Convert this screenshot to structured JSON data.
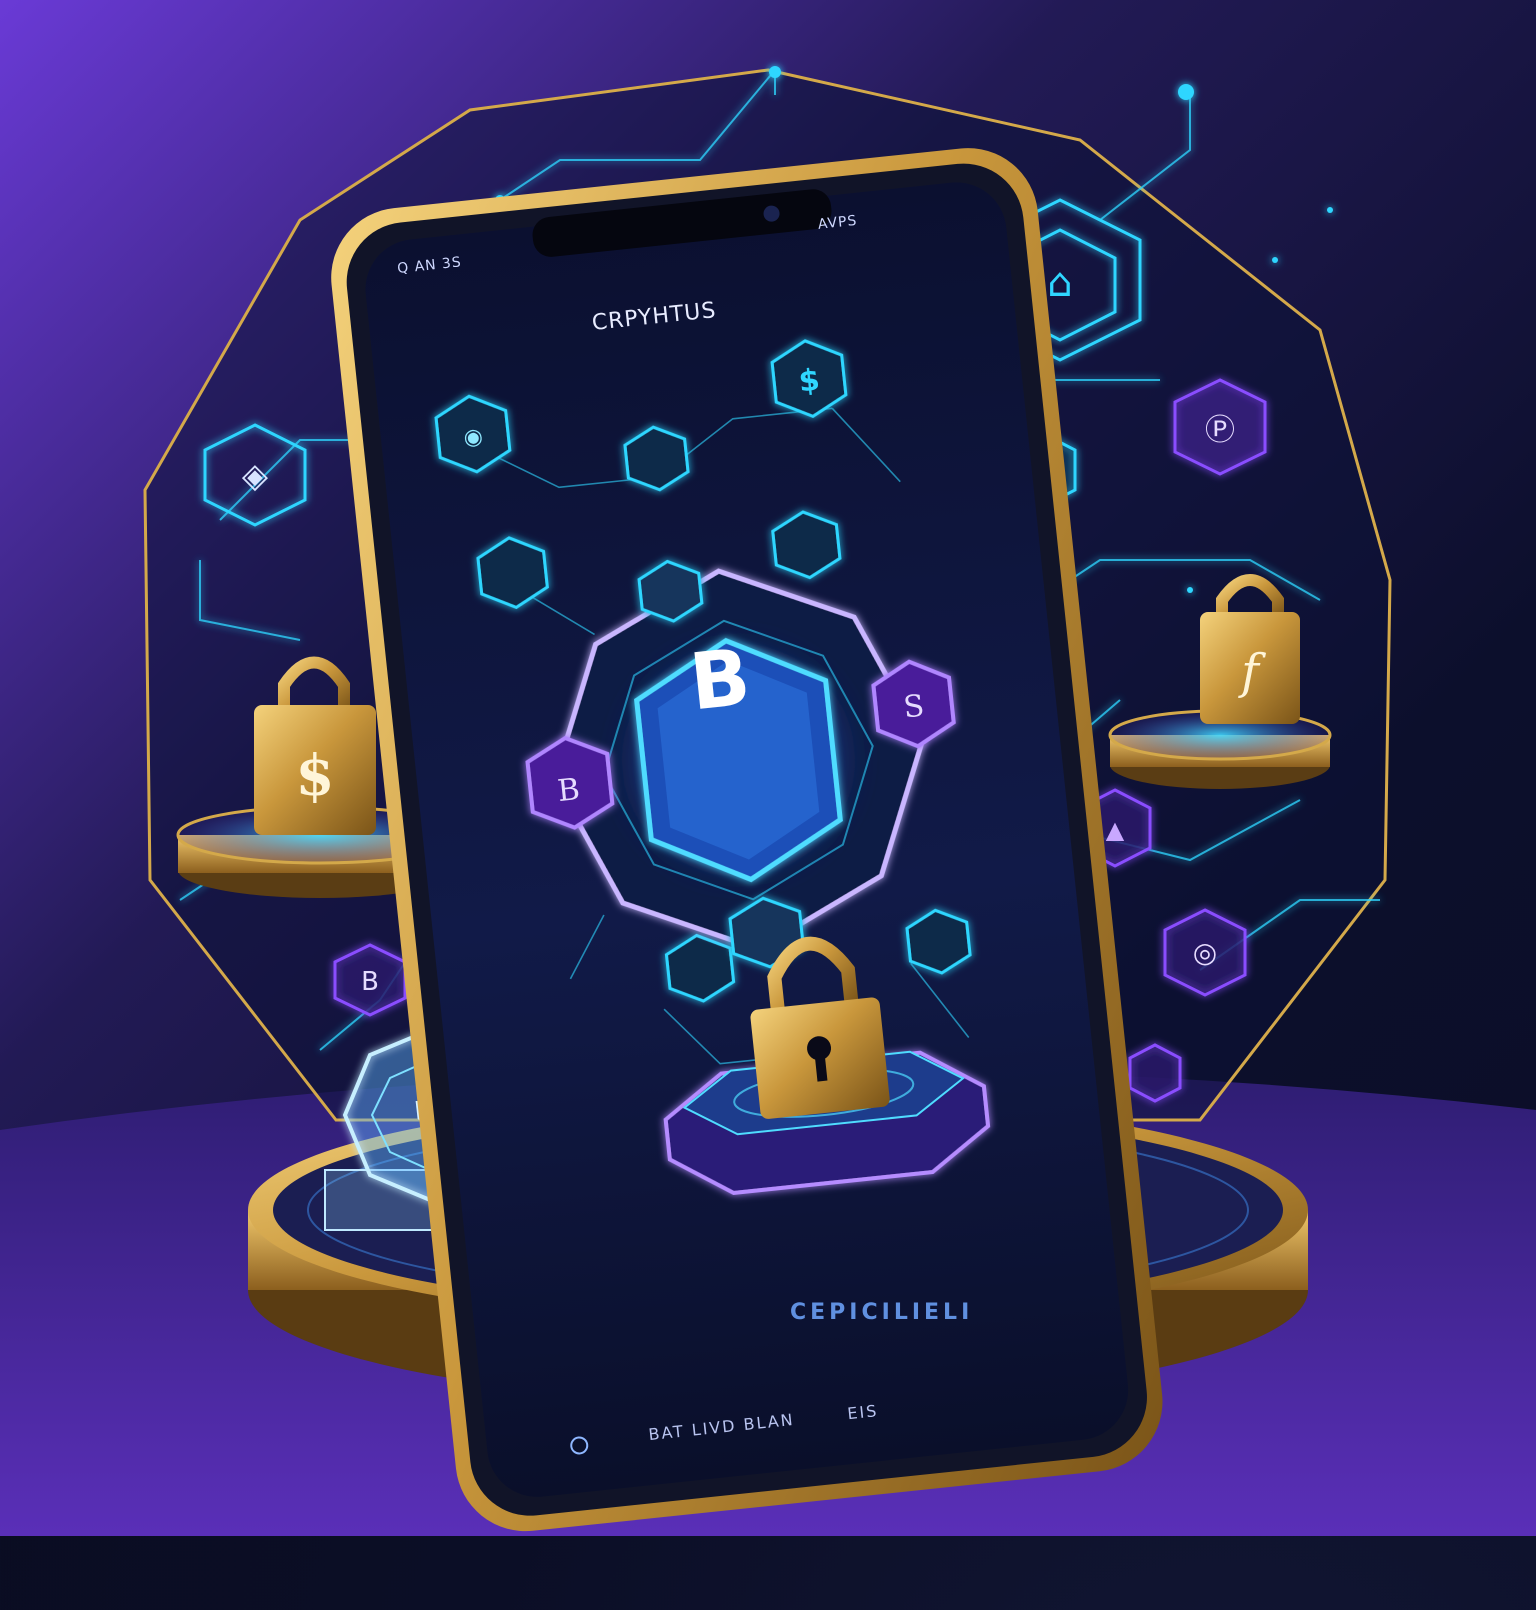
{
  "phone": {
    "status_left": "Q AN 3S",
    "status_right": "AVPS",
    "app_title": "CRPYHTUS",
    "bottom_text": "BAT LIVD BLAN",
    "bottom_right": "EIS"
  },
  "base": {
    "label": "CEPICILIELI"
  },
  "glyphs": {
    "center_coin": "B",
    "left_lock": "$",
    "right_lock": "f",
    "top_right_hex": "$",
    "right_hex_b": "B",
    "left_purple_hex": "B",
    "right_purple_hex": "S"
  },
  "colors": {
    "gold": "#d4a94a",
    "cyan": "#2fd6ff",
    "purple": "#8a4dff",
    "deep_navy": "#0b0e26"
  }
}
